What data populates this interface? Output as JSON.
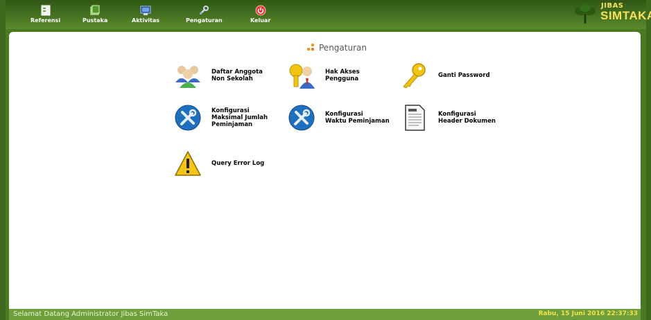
{
  "nav": [
    {
      "label": "Referensi",
      "icon": "reference-icon"
    },
    {
      "label": "Pustaka",
      "icon": "library-icon"
    },
    {
      "label": "Aktivitas",
      "icon": "activity-icon"
    },
    {
      "label": "Pengaturan",
      "icon": "settings-icon"
    },
    {
      "label": "Keluar",
      "icon": "logout-icon"
    }
  ],
  "logo": {
    "line1": "JIBAS",
    "line2": "SIMTAKA"
  },
  "section_title": "Pengaturan",
  "items": [
    {
      "label": "Daftar Anggota\nNon Sekolah",
      "icon": "users-group-icon"
    },
    {
      "label": "Hak Akses\nPengguna",
      "icon": "user-key-icon"
    },
    {
      "label": "Ganti Password",
      "icon": "key-icon"
    },
    {
      "label": "Konfigurasi\nMaksimal Jumlah\nPeminjaman",
      "icon": "tools-icon"
    },
    {
      "label": "Konfigurasi\nWaktu Peminjaman",
      "icon": "tools-icon"
    },
    {
      "label": "Konfigurasi\nHeader Dokumen",
      "icon": "document-icon"
    },
    {
      "label": "Query Error Log",
      "icon": "warning-icon"
    }
  ],
  "status": {
    "welcome": "Selamat Datang Administrator Jibas SimTaka",
    "datetime": "Rabu, 15 Juni 2016 22:37:33"
  },
  "colors": {
    "frame": "#4a7a22",
    "topbar": "#3d6a1a",
    "status_text": "#f2e24a",
    "logo_text": "#f7e15a"
  }
}
